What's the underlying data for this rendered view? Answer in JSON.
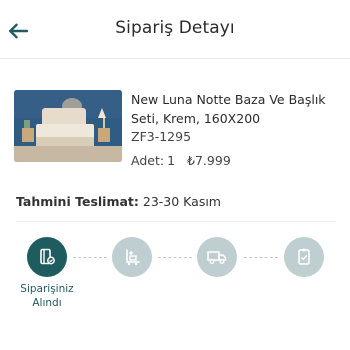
{
  "header": {
    "title": "Sipariş Detayı",
    "back_icon": "arrow-left-icon",
    "accent_color": "#1f5c5f"
  },
  "product": {
    "name": "New Luna Notte Baza Ve Başlık Seti, Krem, 160X200",
    "sku": "ZF3-1295",
    "quantity_label": "Adet:",
    "quantity_value": "1",
    "price": "₺7.999"
  },
  "delivery": {
    "label": "Tahmini Teslimat:",
    "value": "23-30 Kasım"
  },
  "progress": {
    "steps": [
      {
        "icon": "order-document-icon",
        "active": true,
        "label_line1": "Siparişiniz",
        "label_line2": "Alındı"
      },
      {
        "icon": "warehouse-forklift-icon",
        "active": false
      },
      {
        "icon": "delivery-truck-icon",
        "active": false
      },
      {
        "icon": "delivered-checklist-icon",
        "active": false
      }
    ],
    "active_color": "#1f5c5f",
    "inactive_color": "#bfcfd1"
  }
}
